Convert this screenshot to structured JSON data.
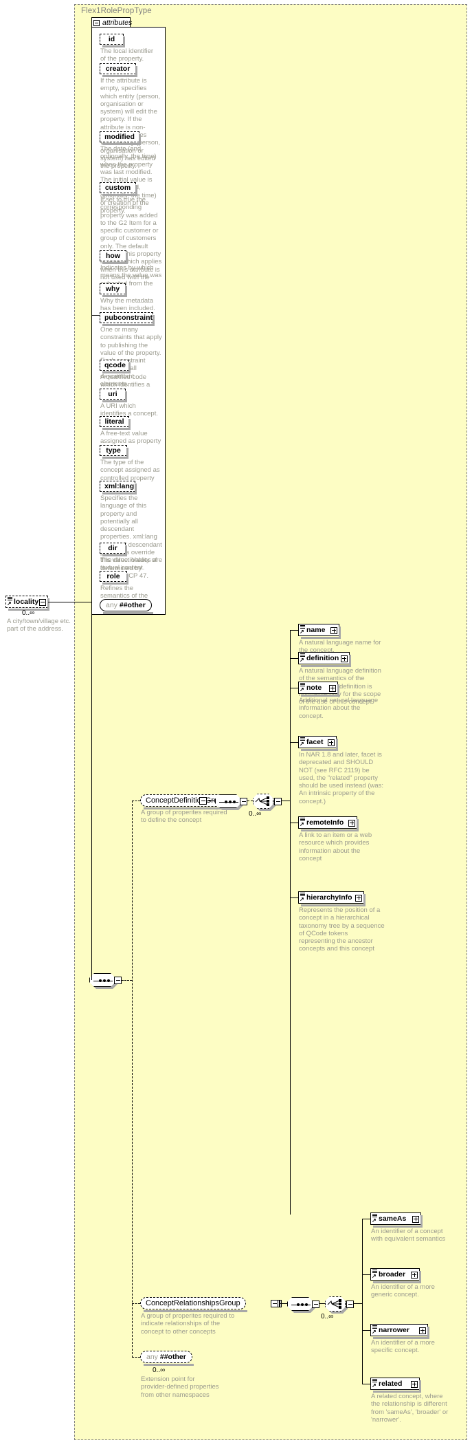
{
  "type_panel": {
    "title": "Flex1RolePropType"
  },
  "attributes_box": {
    "label": "attributes",
    "items": [
      {
        "name": "id",
        "desc": "The local identifier of the property."
      },
      {
        "name": "creator",
        "desc": "If the attribute is empty, specifies which entity (person, organisation or system) will edit the property. If the attribute is non-empty, specifies which entity (person, organisation or system) has edited the property."
      },
      {
        "name": "modified",
        "desc": "The date (and, optionally, the time) when the property was last modified. The initial value is the date (and, optionally, the time) of creation of the property."
      },
      {
        "name": "custom",
        "desc": "If set to true the corresponding property was added to the G2 Item for a specific customer or group of customers only. The default value of this property is false which applies when this attribute is not used with the property."
      },
      {
        "name": "how",
        "desc": "Indicates by which means the value was extracted from the content."
      },
      {
        "name": "why",
        "desc": "Why the metadata has been included."
      },
      {
        "name": "pubconstraint",
        "desc": "One or many constraints that apply to publishing the value of the property. Each constraint applies to all descendant elements."
      },
      {
        "name": "qcode",
        "desc": "A qualified code which identifies a concept."
      },
      {
        "name": "uri",
        "desc": "A URI which identifies a concept."
      },
      {
        "name": "literal",
        "desc": "A free-text value assigned as property value."
      },
      {
        "name": "type",
        "desc": "The type of the concept assigned as controlled property value."
      },
      {
        "name": "xml:lang",
        "desc": "Specifies the language of this property and potentially all descendant properties. xml:lang values of descendant properties override this value. Values are determined by Internet BCP 47."
      },
      {
        "name": "dir",
        "desc": "The directionality of textual content."
      },
      {
        "name": "role",
        "desc": "Refines the semantics of the property"
      }
    ],
    "any": {
      "keyword": "any",
      "namespace": "##other"
    }
  },
  "root_element": {
    "name": "locality",
    "cardinality": "0..∞",
    "desc": "A city/town/village etc. part of the address."
  },
  "concept_definition_group": {
    "name": "ConceptDefinitionGroup",
    "desc": "A group of properites required to define the concept",
    "cardinality": "0..∞",
    "children": [
      {
        "name": "name",
        "desc": "A natural language name for the concept."
      },
      {
        "name": "definition",
        "desc": "A natural language definition of the semantics of the concept. This definition is normative only for the scope of the use of this concept."
      },
      {
        "name": "note",
        "desc": "Additional natural language information about the concept."
      },
      {
        "name": "facet",
        "desc": "In NAR 1.8 and later, facet is deprecated and SHOULD NOT (see RFC 2119) be used, the \"related\" property should be used instead (was: An intrinsic property of the concept.)"
      },
      {
        "name": "remoteInfo",
        "desc": "A link to an item or a web resource which provides information about the concept"
      },
      {
        "name": "hierarchyInfo",
        "desc": "Represents the position of a concept in a hierarchical taxonomy tree by a sequence of QCode tokens representing the ancestor concepts and this concept"
      }
    ]
  },
  "concept_relationships_group": {
    "name": "ConceptRelationshipsGroup",
    "desc": "A group of properites required to indicate relationships of the concept to other concepts",
    "cardinality": "0..∞",
    "children": [
      {
        "name": "sameAs",
        "desc": "An identifier of a concept with equivalent semantics"
      },
      {
        "name": "broader",
        "desc": "An identifier of a more generic concept."
      },
      {
        "name": "narrower",
        "desc": "An identifier of a more specific concept."
      },
      {
        "name": "related",
        "desc": "A related concept, where the relationship is different from 'sameAs', 'broader' or 'narrower'."
      }
    ]
  },
  "extension_any": {
    "keyword": "any",
    "namespace": "##other",
    "cardinality": "0..∞",
    "desc": "Extension point for provider-defined properties from other namespaces"
  },
  "colors": {
    "panel_background": "#fdfdc4",
    "panel_border": "#808080",
    "description_text": "#9a9a8e",
    "node_shadow": "#a8a8a8",
    "line": "#000000"
  }
}
